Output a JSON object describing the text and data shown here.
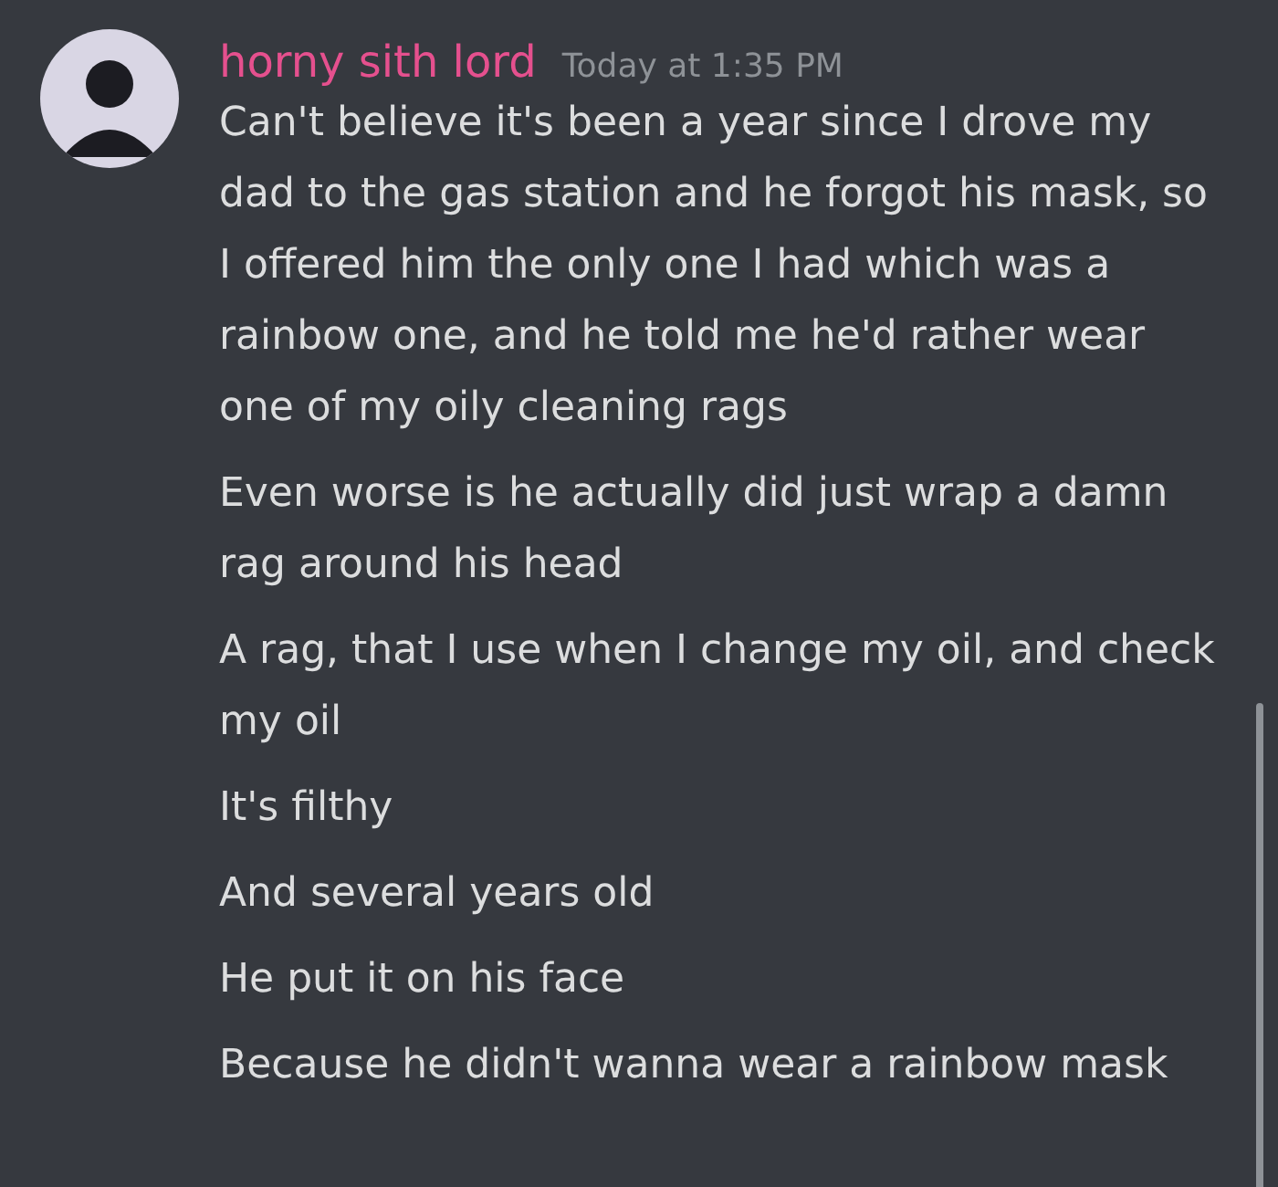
{
  "message_group": {
    "author": "horny sith lord",
    "timestamp": "Today at 1:35 PM",
    "messages": [
      "Can't believe it's been a year since I drove my dad to the gas station and he forgot his mask, so I offered him the only one I had which was a rainbow one, and he told me he'd rather wear one of my oily cleaning rags",
      "Even worse is he actually did just wrap a damn rag around his head",
      "A rag, that I use when I change my oil, and check my oil",
      "It's filthy",
      "And several years old",
      "He put it on his face",
      "Because he didn't wanna wear a rainbow mask"
    ]
  }
}
